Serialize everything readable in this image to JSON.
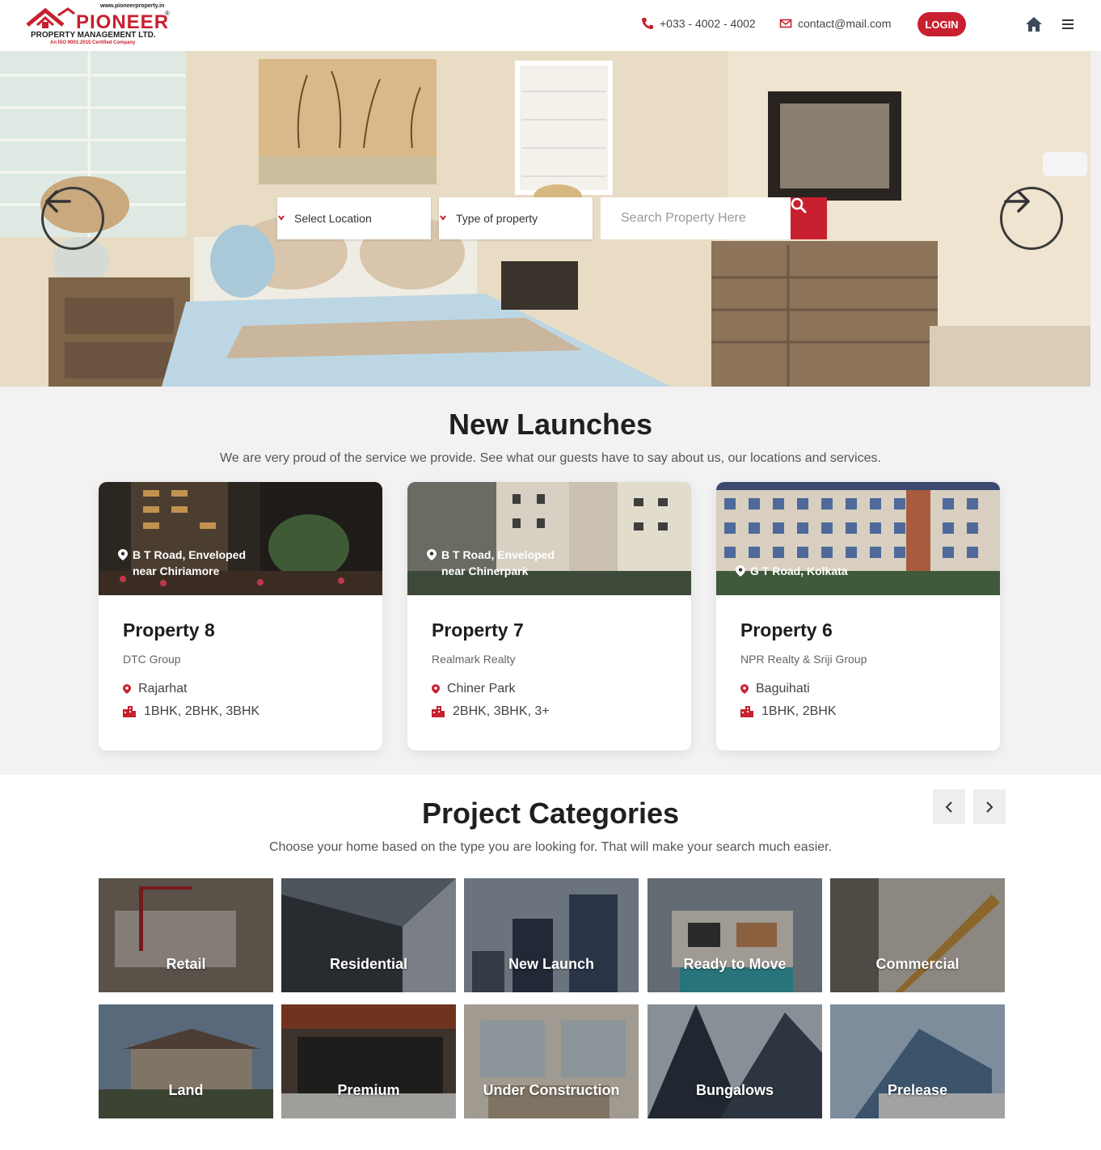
{
  "brand": {
    "url": "www.pioneerproperty.in",
    "name": "PIONEER",
    "reg_mark": "®",
    "subtitle": "PROPERTY MANAGEMENT LTD.",
    "iso": "An ISO 9001:2015 Certified Company",
    "accent_color": "#c8202f"
  },
  "header": {
    "phone": "+033 - 4002 - 4002",
    "email": "contact@mail.com",
    "login_label": "LOGIN",
    "icons": [
      "phone-icon",
      "mail-icon",
      "home-icon",
      "menu-icon"
    ]
  },
  "search": {
    "location_label": "Select Location",
    "type_label": "Type of property",
    "placeholder": "Search Property Here"
  },
  "launches": {
    "title": "New Launches",
    "subtitle": "We are very proud of the service we provide. See what our guests have to say about us, our locations and services.",
    "cards": [
      {
        "overlay_line1": "B T Road, Enveloped",
        "overlay_line2": "near Chiriamore",
        "title": "Property 8",
        "developer": "DTC Group",
        "area": "Rajarhat",
        "config": "1BHK, 2BHK, 3BHK"
      },
      {
        "overlay_line1": "B T Road, Enveloped",
        "overlay_line2": "near Chinerpark",
        "title": "Property 7",
        "developer": "Realmark Realty",
        "area": "Chiner Park",
        "config": "2BHK, 3BHK, 3+"
      },
      {
        "overlay_line1": "G T Road, Kolkata",
        "overlay_line2": "",
        "title": "Property 6",
        "developer": "NPR Realty & Sriji Group",
        "area": "Baguihati",
        "config": "1BHK, 2BHK"
      }
    ]
  },
  "categories": {
    "title": "Project Categories",
    "subtitle": "Choose your home based on the type you are looking for. That will make your search much easier.",
    "items": [
      "Retail",
      "Residential",
      "New Launch",
      "Ready to Move",
      "Commercial",
      "Land",
      "Premium",
      "Under Construction",
      "Bungalows",
      "Prelease"
    ]
  }
}
